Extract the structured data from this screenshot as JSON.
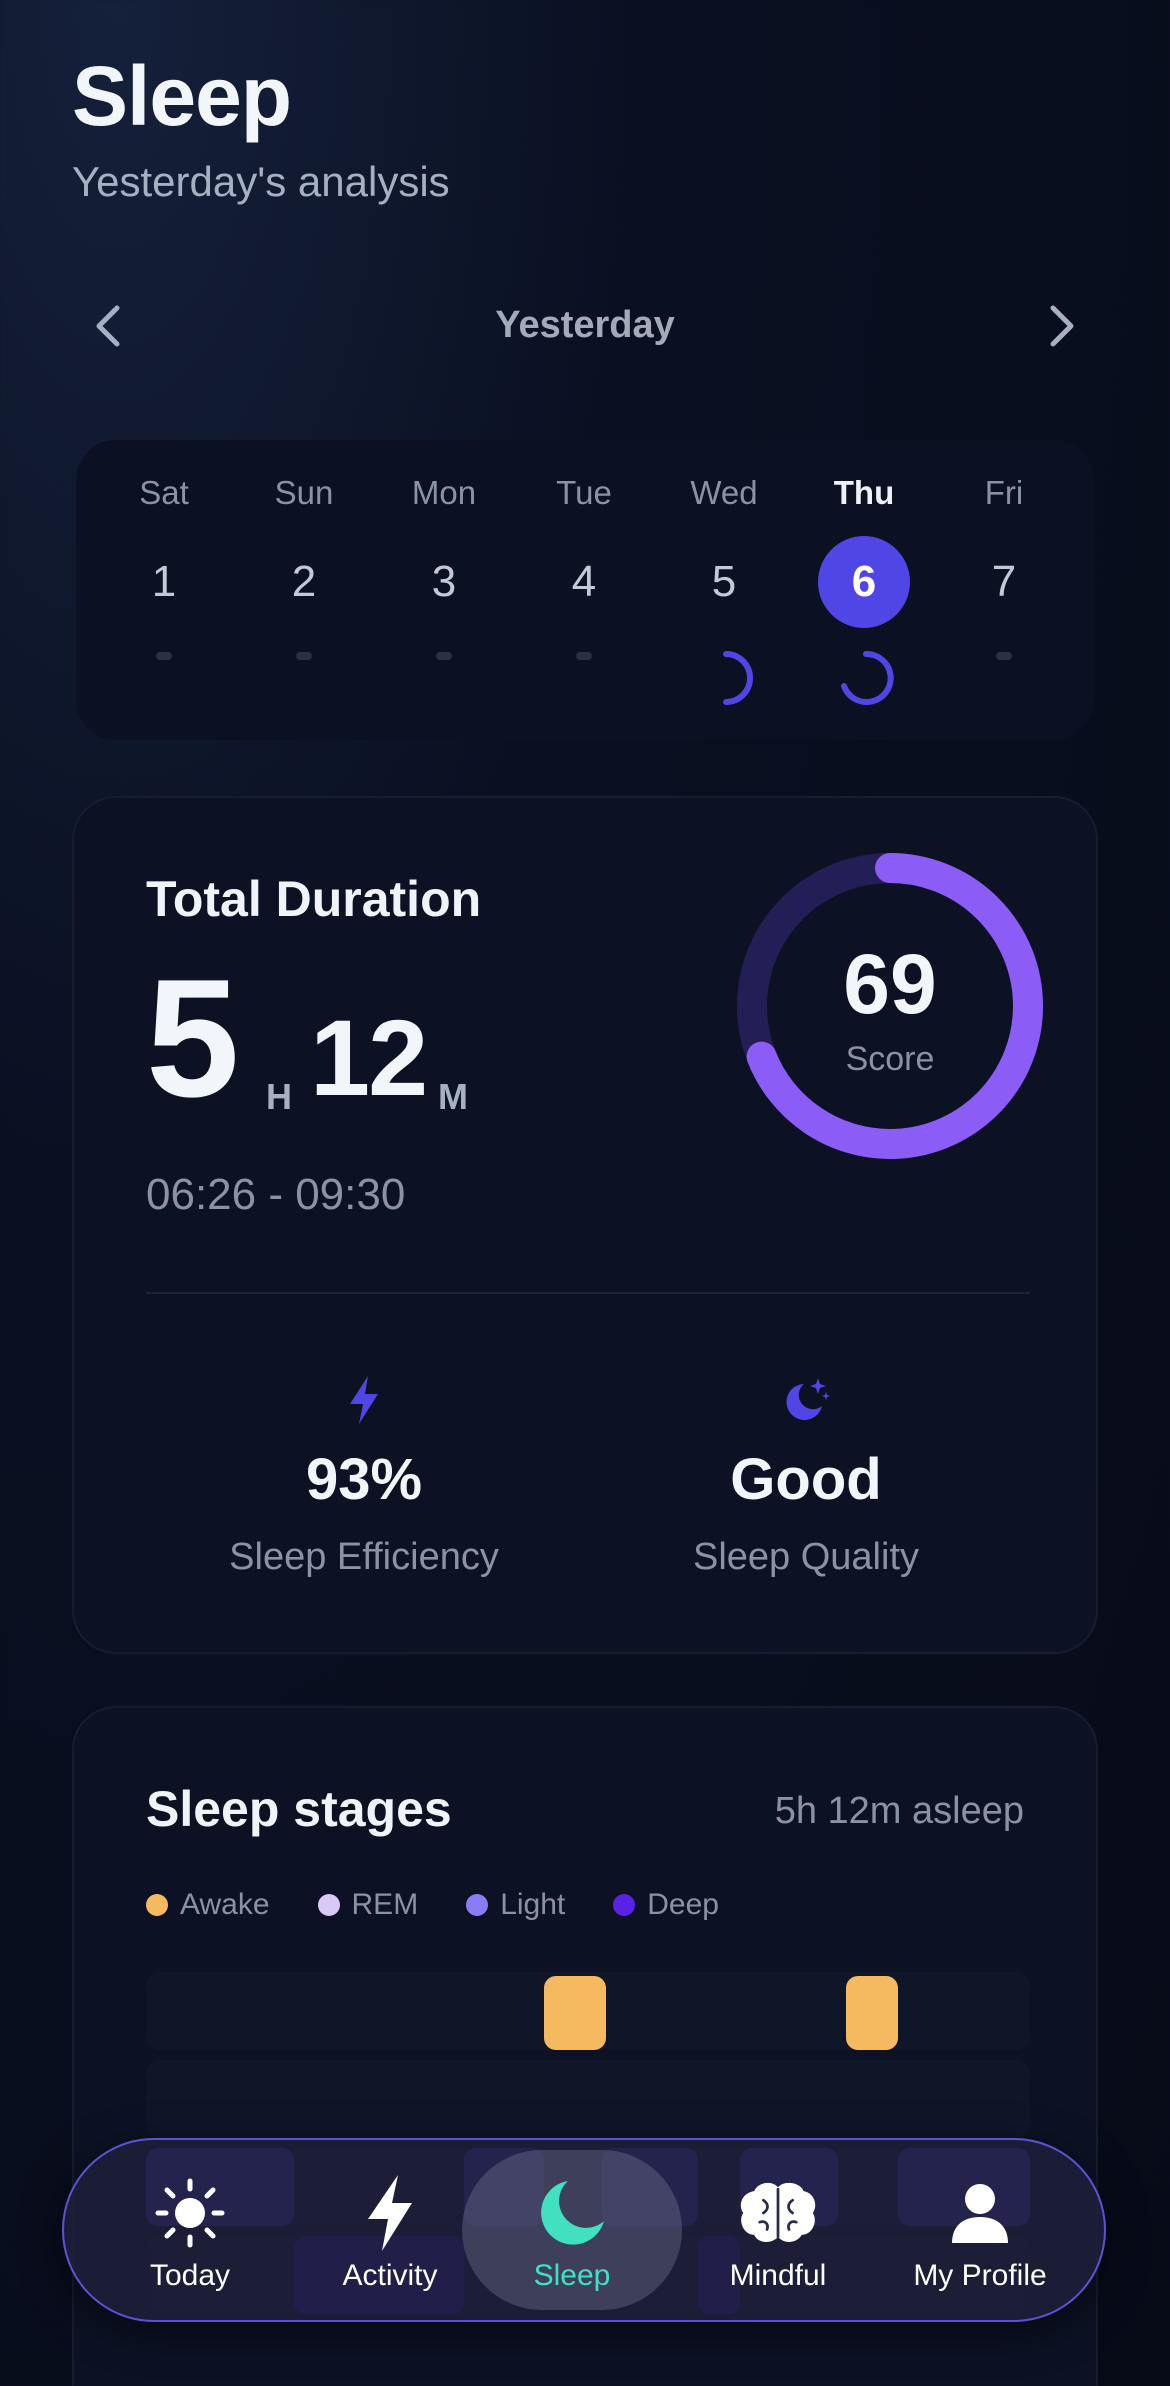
{
  "header": {
    "title": "Sleep",
    "subtitle": "Yesterday's analysis"
  },
  "date_nav": {
    "label": "Yesterday",
    "prev_icon": "chevron-left-icon",
    "next_icon": "chevron-right-icon"
  },
  "week": {
    "days": [
      {
        "name": "Sat",
        "num": "1",
        "active": false,
        "has_sleep": false
      },
      {
        "name": "Sun",
        "num": "2",
        "active": false,
        "has_sleep": false
      },
      {
        "name": "Mon",
        "num": "3",
        "active": false,
        "has_sleep": false
      },
      {
        "name": "Tue",
        "num": "4",
        "active": false,
        "has_sleep": false
      },
      {
        "name": "Wed",
        "num": "5",
        "active": false,
        "has_sleep": true
      },
      {
        "name": "Thu",
        "num": "6",
        "active": true,
        "has_sleep": true
      },
      {
        "name": "Fri",
        "num": "7",
        "active": false,
        "has_sleep": false
      }
    ]
  },
  "duration": {
    "title": "Total Duration",
    "hours": "5",
    "hours_unit": "H",
    "minutes": "12",
    "minutes_unit": "M",
    "range": "06:26 - 09:30",
    "score": "69",
    "score_label": "Score",
    "score_fraction": 0.69,
    "efficiency_value": "93%",
    "efficiency_label": "Sleep Efficiency",
    "efficiency_icon": "lightning-icon",
    "quality_value": "Good",
    "quality_label": "Sleep Quality",
    "quality_icon": "moon-stars-icon"
  },
  "stages": {
    "title": "Sleep stages",
    "asleep": "5h 12m asleep",
    "legend": [
      {
        "label": "Awake",
        "color": "#f5b95f"
      },
      {
        "label": "REM",
        "color": "#d8c9f7"
      },
      {
        "label": "Light",
        "color": "#8b7cf6"
      },
      {
        "label": "Deep",
        "color": "#5b21e6"
      }
    ]
  },
  "tabs": [
    {
      "label": "Today",
      "icon": "sun-icon",
      "active": false
    },
    {
      "label": "Activity",
      "icon": "lightning-icon",
      "active": false
    },
    {
      "label": "Sleep",
      "icon": "moon-icon",
      "active": true
    },
    {
      "label": "Mindful",
      "icon": "brain-icon",
      "active": false
    },
    {
      "label": "My Profile",
      "icon": "person-icon",
      "active": false
    }
  ],
  "colors": {
    "accent": "#4f46e5",
    "score_ring": "#8b5cf6",
    "active_tab": "#40e0c0",
    "awake": "#f5b95f"
  }
}
